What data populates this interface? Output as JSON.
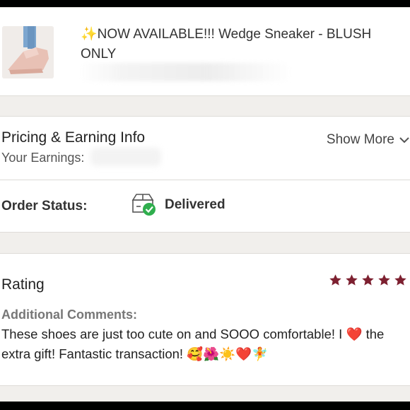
{
  "listing": {
    "title": "✨NOW AVAILABLE!!! Wedge Sneaker - BLUSH ONLY",
    "thumbnail_icon": "product-photo"
  },
  "pricing": {
    "title": "Pricing & Earning Info",
    "earnings_label": "Your Earnings:",
    "show_more_label": "Show More",
    "show_more_icon": "chevron-down-icon"
  },
  "order_status": {
    "label": "Order Status:",
    "value": "Delivered",
    "icon": "package-delivered-icon",
    "icon_check_color": "#2fae4d"
  },
  "rating": {
    "label": "Rating",
    "stars": 5,
    "max_stars": 5,
    "star_color": "#7d2030",
    "comments_label": "Additional Comments:",
    "comment_text_1": "These shoes are just too cute on and SOOO comfortable! I",
    "comment_heart": "❤️",
    "comment_text_2": "the extra gift! Fantastic transaction!",
    "comment_emojis": "🥰🌺☀️❤️🧚"
  }
}
